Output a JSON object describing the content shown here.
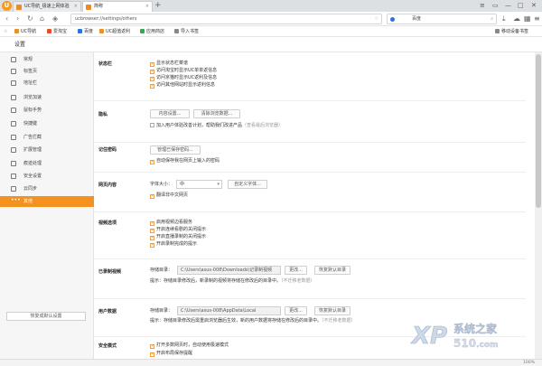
{
  "tabs": [
    {
      "title": "UC导航_极速上网体验",
      "active": false
    },
    {
      "title": "简称",
      "active": true
    }
  ],
  "window_controls": [
    "≡",
    "▭",
    "—",
    "□",
    "✕"
  ],
  "toolbar": {
    "address": "ucbrowser://settings/others",
    "search_engine": "百度",
    "search_icon": "magnifier-icon"
  },
  "bookmarks": [
    {
      "label": "UC导航",
      "color": "#e8912a"
    },
    {
      "label": "爱淘宝",
      "color": "#e84a2a"
    },
    {
      "label": "百度",
      "color": "#2f6fe0"
    },
    {
      "label": "UC超值返利",
      "color": "#e8912a"
    },
    {
      "label": "应用商店",
      "color": "#3aa55a"
    },
    {
      "label": "导入书签",
      "color": "#888888"
    }
  ],
  "mobile_bookmarks": "移动设备书签",
  "page_title": "设置",
  "sidebar": {
    "items": [
      {
        "label": "常规",
        "active": false
      },
      {
        "label": "标签页",
        "active": false
      },
      {
        "label": "地址栏",
        "active": false
      },
      {
        "label": "浏览加速",
        "active": false
      },
      {
        "label": "鼠标手势",
        "active": false
      },
      {
        "label": "快捷键",
        "active": false
      },
      {
        "label": "广告拦截",
        "active": false
      },
      {
        "label": "扩展管理",
        "active": false
      },
      {
        "label": "痕迹处理",
        "active": false
      },
      {
        "label": "安全设置",
        "active": false
      },
      {
        "label": "云同步",
        "active": false
      },
      {
        "label": "其他",
        "active": true
      }
    ],
    "restore_button": "恢复成默认设置"
  },
  "sections": {
    "statusbar": {
      "title": "状态栏",
      "options": [
        {
          "label": "显示状态栏菜谱",
          "checked": true
        },
        {
          "label": "访问淘宝时显示UC单单返信息",
          "checked": true
        },
        {
          "label": "访问京猫时显示UC返利及信息",
          "checked": true
        },
        {
          "label": "访问其他网站时显示返利信息",
          "checked": true
        }
      ]
    },
    "privacy": {
      "title": "隐私",
      "content_settings": "内容设置...",
      "clear_data": "清除浏览数据...",
      "join_plan": "加入用户体验改善计划，帮助我们改进产品",
      "join_plan_note": "（查看最后浏览器）",
      "join_checked": false
    },
    "passwords": {
      "title": "记住密码",
      "manage_button": "管理已保存密码...",
      "autosave": "自动保存我在网页上输入的密码",
      "autosave_checked": true
    },
    "web_content": {
      "title": "网页内容",
      "font_size_label": "字体大小：",
      "font_size_value": "中",
      "custom_font_button": "自定义字体...",
      "simplified": "翻译非中文网页",
      "simplified_checked": true
    },
    "video": {
      "title": "视频选项",
      "options": [
        {
          "label": "启用视频边看服务",
          "checked": true
        },
        {
          "label": "开启连续看剧的关闭提示",
          "checked": true
        },
        {
          "label": "开启直播录制的关闭提示",
          "checked": true
        },
        {
          "label": "开启录制完成的提示",
          "checked": true
        }
      ]
    },
    "recorded_video": {
      "title": "已录制视频",
      "path_label": "存储目录：",
      "path_value": "C:\\Users\\asus-008\\Downloads\\记录制视频",
      "change_button": "更改...",
      "default_button": "恢复默认目录",
      "note": "提示：存储目录修改后，新录制的视频将存储在修改后的目录中。",
      "note_link": "（不迁移老数据）"
    },
    "user_data": {
      "title": "用户数据",
      "path_label": "存储目录：",
      "path_value": "C:\\Users\\asus-008\\AppData\\Local",
      "change_button": "更改...",
      "default_button": "恢复默认目录",
      "note": "提示：存储目录修改后需重启浏览器后生效，新的用户数据将存储在修改后的目录中。",
      "note_link": "（不迁移老数据）"
    },
    "safe_mode": {
      "title": "安全模式",
      "options": [
        {
          "label": "打开多数网页时，自动使用极速模式",
          "checked": true
        },
        {
          "label": "开启布局保存提醒",
          "checked": true
        }
      ]
    }
  },
  "watermark": {
    "brand": "XP",
    "site": "系统之家",
    "num": "510",
    "domain": ".com"
  },
  "zoom": "100%"
}
